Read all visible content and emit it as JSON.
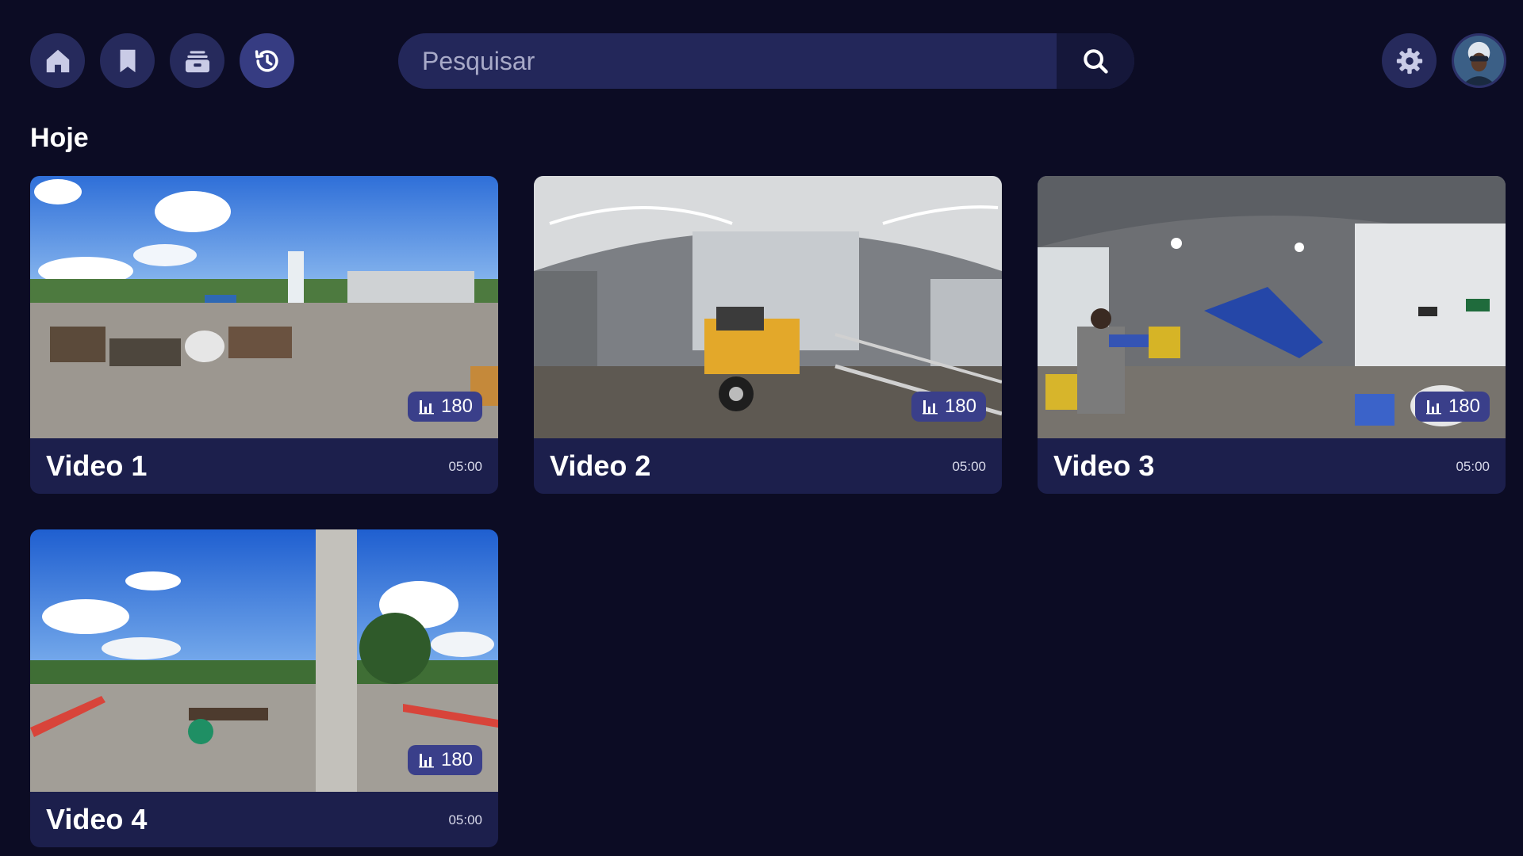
{
  "nav": {
    "items": [
      {
        "name": "home",
        "icon": "home-icon"
      },
      {
        "name": "bookmarks",
        "icon": "bookmark-icon"
      },
      {
        "name": "library",
        "icon": "media-box-icon"
      },
      {
        "name": "history",
        "icon": "history-icon",
        "active": true
      }
    ]
  },
  "search": {
    "placeholder": "Pesquisar",
    "value": "",
    "icon": "search-icon"
  },
  "header": {
    "settings_icon": "gear-icon",
    "avatar_icon": "avatar"
  },
  "section": {
    "title": "Hoje"
  },
  "videos": [
    {
      "title": "Video 1",
      "duration": "05:00",
      "badge": "180",
      "badge_icon": "bar-chart-icon",
      "scene": "outdoor-yard"
    },
    {
      "title": "Video 2",
      "duration": "05:00",
      "badge": "180",
      "badge_icon": "bar-chart-icon",
      "scene": "warehouse-machine"
    },
    {
      "title": "Video 3",
      "duration": "05:00",
      "badge": "180",
      "badge_icon": "bar-chart-icon",
      "scene": "warehouse-worker"
    },
    {
      "title": "Video 4",
      "duration": "05:00",
      "badge": "180",
      "badge_icon": "bar-chart-icon",
      "scene": "outdoor-pole"
    }
  ],
  "colors": {
    "background": "#0c0c24",
    "nav_button": "#262a5c",
    "nav_button_active": "#363c82",
    "search_bg": "#23275a",
    "card_footer": "#1c1f4c",
    "badge": "#3a3f8a"
  }
}
